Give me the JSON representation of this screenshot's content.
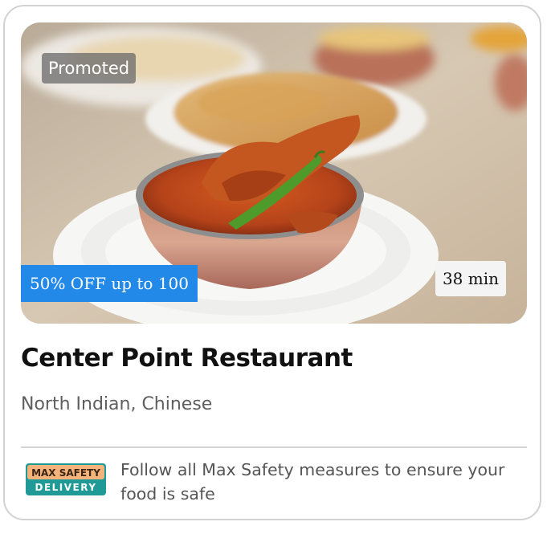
{
  "card": {
    "promoted_label": "Promoted",
    "discount_label": "50% OFF up to 100",
    "delivery_time": "38 min",
    "restaurant_name": "Center Point Restaurant",
    "cuisines": "North Indian, Chinese",
    "image_subject": "chicken curry in copper bowl",
    "safety": {
      "badge_line1": "MAX SAFETY",
      "badge_line2": "DELIVERY",
      "message": "Follow all Max Safety measures to ensure your food is safe"
    }
  },
  "colors": {
    "discount_bg": "#2389e8",
    "badge_teal": "#1f9a96",
    "badge_peach": "#f3b37a"
  }
}
